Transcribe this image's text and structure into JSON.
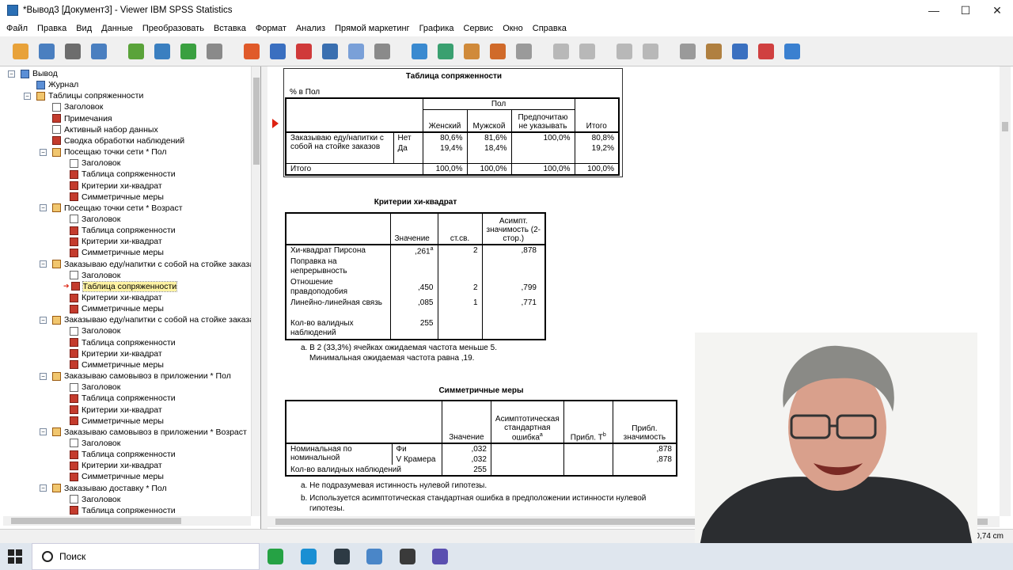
{
  "window": {
    "title": "*Вывод3 [Документ3] - Viewer IBM SPSS Statistics",
    "min": "—",
    "max": "☐",
    "close": "✕"
  },
  "menu": [
    "Файл",
    "Правка",
    "Вид",
    "Данные",
    "Преобразовать",
    "Вставка",
    "Формат",
    "Анализ",
    "Прямой маркетинг",
    "Графика",
    "Сервис",
    "Окно",
    "Справка"
  ],
  "toolbar_icons": [
    "open-icon",
    "save-icon",
    "print-icon",
    "print-preview-icon",
    "export-icon",
    "recall-dialog-icon",
    "undo-icon",
    "redo-icon",
    "goto-data-icon",
    "goto-case-icon",
    "goto-variable-icon",
    "variables-icon",
    "find-icon",
    "split-file-icon",
    "select-cases-icon",
    "value-labels-icon",
    "use-sets-icon",
    "show-all-icon",
    "designate-window-icon",
    "back-icon",
    "forward-icon",
    "expand-icon",
    "collapse-icon",
    "show-icon",
    "hide-icon",
    "insert-heading-icon",
    "insert-title-icon",
    "insert-text-icon"
  ],
  "tree": [
    {
      "label": "Вывод",
      "icon": "log",
      "level": 0,
      "exp": "⊟"
    },
    {
      "label": "Журнал",
      "icon": "log",
      "level": 1
    },
    {
      "label": "Таблицы сопряженности",
      "icon": "book",
      "level": 1,
      "exp": "⊟"
    },
    {
      "label": "Заголовок",
      "icon": "page",
      "level": 2
    },
    {
      "label": "Примечания",
      "icon": "tab",
      "level": 2
    },
    {
      "label": "Активный набор данных",
      "icon": "page",
      "level": 2
    },
    {
      "label": "Сводка обработки наблюдений",
      "icon": "tab",
      "level": 2
    },
    {
      "label": "Посещаю точки сети * Пол",
      "icon": "book",
      "level": 2,
      "exp": "⊟"
    },
    {
      "label": "Заголовок",
      "icon": "page",
      "level": 3
    },
    {
      "label": "Таблица сопряженности",
      "icon": "tab",
      "level": 3
    },
    {
      "label": "Критерии хи-квадрат",
      "icon": "tab",
      "level": 3
    },
    {
      "label": "Симметричные меры",
      "icon": "tab",
      "level": 3
    },
    {
      "label": "Посещаю точки сети * Возраст",
      "icon": "book",
      "level": 2,
      "exp": "⊟"
    },
    {
      "label": "Заголовок",
      "icon": "page",
      "level": 3
    },
    {
      "label": "Таблица сопряженности",
      "icon": "tab",
      "level": 3
    },
    {
      "label": "Критерии хи-квадрат",
      "icon": "tab",
      "level": 3
    },
    {
      "label": "Симметричные меры",
      "icon": "tab",
      "level": 3
    },
    {
      "label": "Заказываю еду/напитки с собой на стойке заказа",
      "icon": "book",
      "level": 2,
      "exp": "⊟"
    },
    {
      "label": "Заголовок",
      "icon": "page",
      "level": 3
    },
    {
      "label": "Таблица сопряженности",
      "icon": "tab",
      "level": 3,
      "selected": true
    },
    {
      "label": "Критерии хи-квадрат",
      "icon": "tab",
      "level": 3
    },
    {
      "label": "Симметричные меры",
      "icon": "tab",
      "level": 3
    },
    {
      "label": "Заказываю еду/напитки с собой на стойке заказа",
      "icon": "book",
      "level": 2,
      "exp": "⊟"
    },
    {
      "label": "Заголовок",
      "icon": "page",
      "level": 3
    },
    {
      "label": "Таблица сопряженности",
      "icon": "tab",
      "level": 3
    },
    {
      "label": "Критерии хи-квадрат",
      "icon": "tab",
      "level": 3
    },
    {
      "label": "Симметричные меры",
      "icon": "tab",
      "level": 3
    },
    {
      "label": "Заказываю самовывоз в приложении * Пол",
      "icon": "book",
      "level": 2,
      "exp": "⊟"
    },
    {
      "label": "Заголовок",
      "icon": "page",
      "level": 3
    },
    {
      "label": "Таблица сопряженности",
      "icon": "tab",
      "level": 3
    },
    {
      "label": "Критерии хи-квадрат",
      "icon": "tab",
      "level": 3
    },
    {
      "label": "Симметричные меры",
      "icon": "tab",
      "level": 3
    },
    {
      "label": "Заказываю самовывоз в приложении * Возраст",
      "icon": "book",
      "level": 2,
      "exp": "⊟"
    },
    {
      "label": "Заголовок",
      "icon": "page",
      "level": 3
    },
    {
      "label": "Таблица сопряженности",
      "icon": "tab",
      "level": 3
    },
    {
      "label": "Критерии хи-квадрат",
      "icon": "tab",
      "level": 3
    },
    {
      "label": "Симметричные меры",
      "icon": "tab",
      "level": 3
    },
    {
      "label": "Заказываю доставку * Пол",
      "icon": "book",
      "level": 2,
      "exp": "⊟"
    },
    {
      "label": "Заголовок",
      "icon": "page",
      "level": 3
    },
    {
      "label": "Таблица сопряженности",
      "icon": "tab",
      "level": 3
    }
  ],
  "crosstab": {
    "title": "Таблица сопряженности",
    "subtitle": "% в Пол",
    "col_group": "Пол",
    "cols": [
      "Женский",
      "Мужской",
      "Предпочитаю не указывать",
      "Итого"
    ],
    "row_var": "Заказываю еду/напитки с собой на стойке заказов",
    "rows": [
      {
        "label": "Нет",
        "vals": [
          "80,6%",
          "81,6%",
          "100,0%",
          "80,8%"
        ]
      },
      {
        "label": "Да",
        "vals": [
          "19,4%",
          "18,4%",
          "",
          "19,2%"
        ]
      }
    ],
    "total": {
      "label": "Итого",
      "vals": [
        "100,0%",
        "100,0%",
        "100,0%",
        "100,0%"
      ]
    }
  },
  "chisq": {
    "title": "Критерии хи-квадрат",
    "cols": [
      "Значение",
      "ст.св.",
      "Асимпт. значимость (2-стор.)"
    ],
    "rows": [
      {
        "label": "Хи-квадрат Пирсона",
        "vals": [
          ",261",
          "2",
          ",878"
        ],
        "sup": "a"
      },
      {
        "label": "Поправка на непрерывность",
        "vals": [
          "",
          "",
          ""
        ]
      },
      {
        "label": "Отношение правдоподобия",
        "vals": [
          ",450",
          "2",
          ",799"
        ]
      },
      {
        "label": "Линейно-линейная связь",
        "vals": [
          ",085",
          "1",
          ",771"
        ]
      },
      {
        "label": "Кол-во валидных наблюдений",
        "vals": [
          "255",
          "",
          ""
        ]
      }
    ],
    "foot_a": "a. В 2 (33,3%) ячейках ожидаемая частота меньше 5.",
    "foot_b": "Минимальная ожидаемая частота равна ,19."
  },
  "symm": {
    "title": "Симметричные меры",
    "cols": [
      "Значение",
      "Асимптотическая стандартная ошибка",
      "Прибл. T",
      "Прибл. значимость"
    ],
    "sup": [
      "",
      "a",
      "b",
      ""
    ],
    "group": "Номинальная по номинальной",
    "rows": [
      {
        "label": "Фи",
        "vals": [
          ",032",
          "",
          "",
          ",878"
        ]
      },
      {
        "label": "V Крамера",
        "vals": [
          ",032",
          "",
          "",
          ",878"
        ]
      }
    ],
    "total": {
      "label": "Кол-во валидных наблюдений",
      "vals": [
        "255",
        "",
        "",
        ""
      ]
    },
    "foot_a": "a. Не подразумевая истинность нулевой гипотезы.",
    "foot_b": "b. Используется асимптотическая стандартная ошибка в предположении истинности нулевой",
    "foot_c": "гипотезы."
  },
  "status": {
    "dims": "W: 10,74 cm"
  },
  "taskbar": {
    "search": "Поиск"
  }
}
